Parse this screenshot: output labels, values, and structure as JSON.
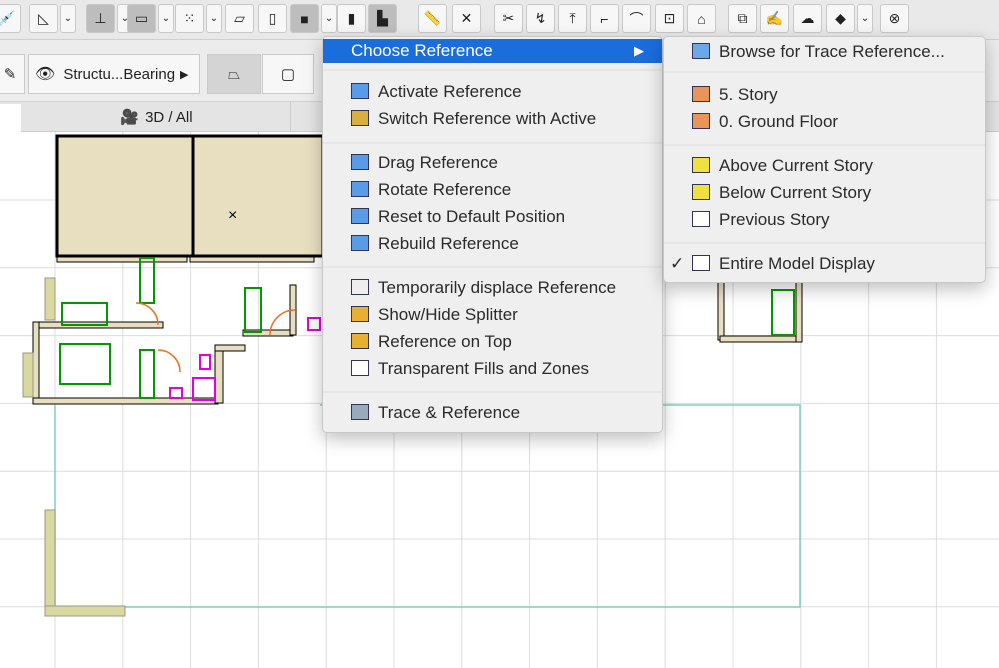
{
  "toolbar": {
    "icons": [
      "syringe-icon",
      "dimension-icon",
      "level-icon",
      "label-icon",
      "grid-icon",
      "slab-icon",
      "plane-icon",
      "trace-reference-icon",
      "object-icon",
      "stair-icon",
      "ruler-icon",
      "close-x-icon",
      "split-icon",
      "adjust-icon",
      "elevate-icon",
      "corner-icon",
      "curve-icon",
      "offset-icon",
      "roof-icon",
      "resize-icon",
      "pen-icon",
      "cloud-icon",
      "3d-view-icon",
      "no-comment-icon"
    ]
  },
  "row2": {
    "layer_label": "Structu...Bearing",
    "view_tab": "3D / All"
  },
  "menu": {
    "items": [
      {
        "label": "Choose Reference",
        "icon": "none",
        "highlighted": true,
        "submenu": true
      },
      {
        "label": "Activate Reference",
        "icon": "activate-reference-icon"
      },
      {
        "label": "Switch Reference with Active",
        "icon": "switch-reference-icon"
      },
      {
        "label": "Drag Reference",
        "icon": "drag-reference-icon"
      },
      {
        "label": "Rotate Reference",
        "icon": "rotate-reference-icon"
      },
      {
        "label": "Reset to Default Position",
        "icon": "reset-position-icon"
      },
      {
        "label": "Rebuild Reference",
        "icon": "rebuild-reference-icon"
      },
      {
        "label": "Temporarily displace Reference",
        "icon": "hand-icon"
      },
      {
        "label": "Show/Hide Splitter",
        "icon": "splitter-icon"
      },
      {
        "label": "Reference on Top",
        "icon": "reference-on-top-icon"
      },
      {
        "label": "Transparent Fills and Zones",
        "icon": "transparent-fills-icon"
      },
      {
        "label": "Trace & Reference",
        "icon": "trace-reference-icon"
      }
    ]
  },
  "submenu": {
    "items": [
      {
        "label": "Browse for Trace Reference...",
        "icon": "folder-icon"
      },
      {
        "label": "5. Story",
        "icon": "story-icon"
      },
      {
        "label": "0. Ground Floor",
        "icon": "story-icon"
      },
      {
        "label": "Above Current Story",
        "icon": "above-story-icon"
      },
      {
        "label": "Below Current Story",
        "icon": "below-story-icon"
      },
      {
        "label": "Previous Story",
        "icon": "previous-story-icon"
      },
      {
        "label": "Entire Model Display",
        "icon": "previous-story-icon",
        "checked": true,
        "check": "✓"
      }
    ]
  },
  "colors": {
    "highlight": "#1a6ddb",
    "wall": "#e8dfc0",
    "green": "#009900",
    "magenta": "#e000e0",
    "grid": "#dcdcdc",
    "zone": "#7fd0c0"
  }
}
